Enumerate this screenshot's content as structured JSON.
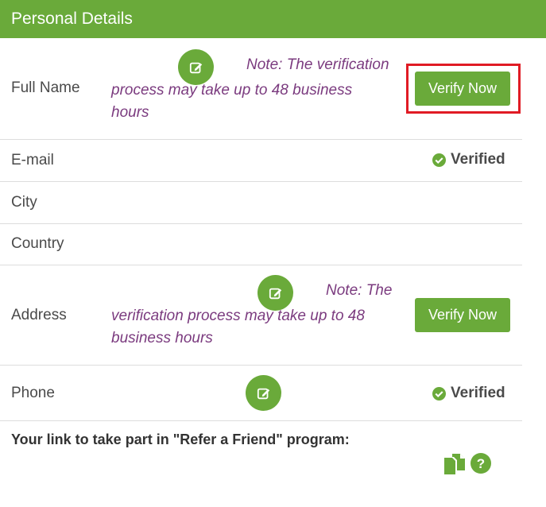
{
  "header": {
    "title": "Personal Details"
  },
  "rows": {
    "full_name": {
      "label": "Full Name",
      "note_line1": "Note: The verification",
      "note_line2": "process may take up to 48 business",
      "note_line3": "hours",
      "verify_label": "Verify Now"
    },
    "email": {
      "label": "E-mail",
      "status": "Verified"
    },
    "city": {
      "label": "City"
    },
    "country": {
      "label": "Country"
    },
    "address": {
      "label": "Address",
      "note_line1": "Note: The",
      "note_line2": "verification process may take up to 48",
      "note_line3": "business hours",
      "verify_label": "Verify Now"
    },
    "phone": {
      "label": "Phone",
      "status": "Verified"
    }
  },
  "refer": {
    "text": "Your link to take part in \"Refer a Friend\" program:"
  },
  "colors": {
    "accent": "#6aaa3a",
    "note": "#7b3b7f",
    "highlight": "#e01b24"
  },
  "icons": [
    "edit-icon",
    "check-circle-icon",
    "copy-icon",
    "help-icon"
  ]
}
